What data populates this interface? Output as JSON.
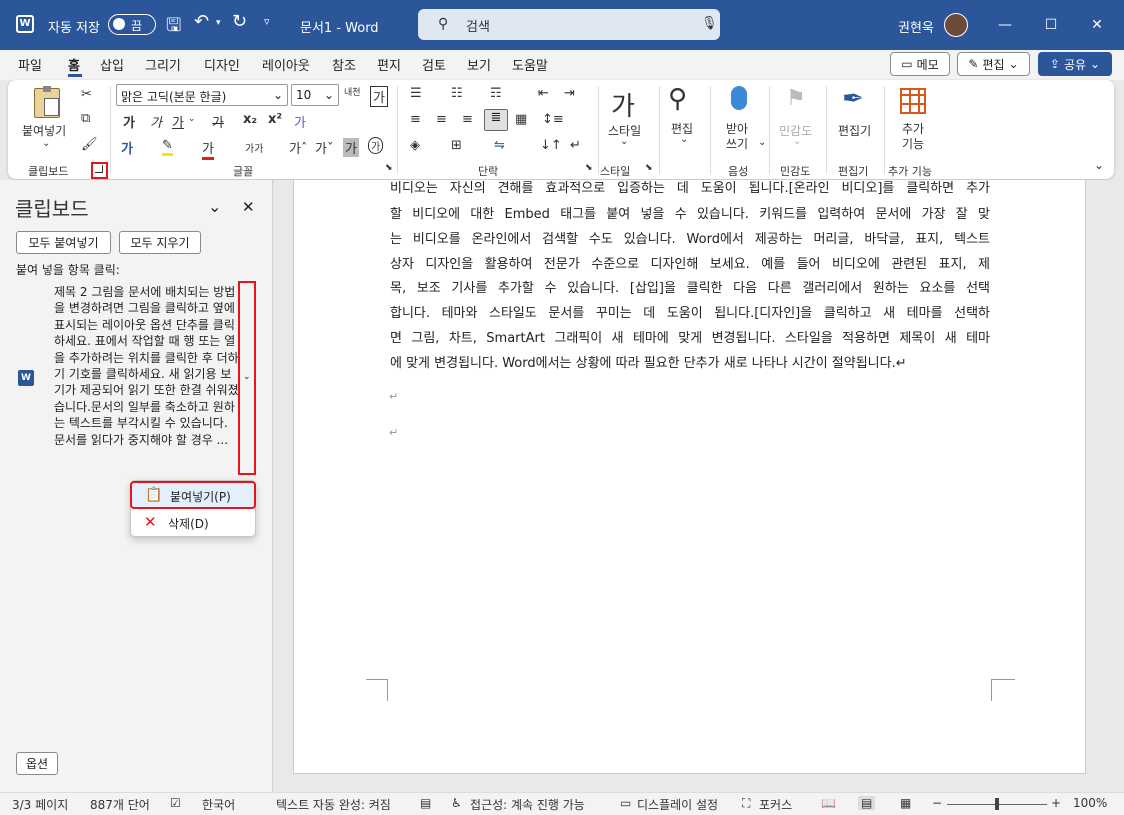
{
  "titlebar": {
    "autosave_label": "자동 저장",
    "autosave_state": "끔",
    "doc_title": "문서1 - Word",
    "search_placeholder": "검색",
    "user_name": "권현욱"
  },
  "menu": [
    "파일",
    "홈",
    "삽입",
    "그리기",
    "디자인",
    "레이아웃",
    "참조",
    "편지",
    "검토",
    "보기",
    "도움말"
  ],
  "menu_active": "홈",
  "top_buttons": {
    "memo": "메모",
    "edit": "편집",
    "share": "공유"
  },
  "ribbon": {
    "paste": "붙여넣기",
    "font_name": "맑은 고딕(본문 한글)",
    "font_size": "10",
    "style_label": "스타일",
    "editing_label": "편집",
    "dictate_label": "받아\n쓰기",
    "sensitivity_label": "민감도",
    "editor_label": "편집기",
    "addins_label": "추가\n기능",
    "groups": [
      "클립보드",
      "글꼴",
      "단락",
      "스타일",
      "음성",
      "민감도",
      "편집기",
      "추가 기능"
    ]
  },
  "clipboard_pane": {
    "title": "클립보드",
    "paste_all": "모두 붙여넣기",
    "clear_all": "모두 지우기",
    "instruction": "붙여 넣을 항목 클릭:",
    "item_text": "제목 2 그림을 문서에 배치되는 방법을 변경하려면 그림을 클릭하고 옆에 표시되는 레이아웃 옵션 단추를 클릭하세요. 표에서 작업할 때 행 또는 열을 추가하려는 위치를 클릭한 후 더하기 기호를 클릭하세요. 새 읽기용 보기가 제공되어 읽기 또한 한결 쉬워졌습니다.문서의 일부를 축소하고 원하는 텍스트를 부각시킬 수 있습니다. 문서를 읽다가 중지해야 할 경우 ...",
    "options": "옵션"
  },
  "context_menu": {
    "paste": "붙여넣기(P)",
    "delete": "삭제(D)"
  },
  "document_lines": [
    "비디오는 자신의 견해를 효과적으로 입증하는 데 도움이 됩니다.[온라인 비디오]를 클릭하면 추가",
    "할 비디오에 대한 Embed 태그를 붙여 넣을 수 있습니다. 키워드를 입력하여 문서에 가장 잘 맞",
    "는 비디오를 온라인에서 검색할 수도 있습니다. Word에서 제공하는 머리글, 바닥글, 표지, 텍스트",
    "상자 디자인을 활용하여 전문가 수준으로 디자인해 보세요. 예를 들어 비디오에 관련된 표지, 제",
    "목, 보조 기사를 추가할 수 있습니다. [삽입]을 클릭한 다음 다른 갤러리에서 원하는 요소를 선택",
    "합니다. 테마와 스타일도 문서를 꾸미는 데 도움이 됩니다.[디자인]을 클릭하고 새 테마를 선택하",
    "면 그림, 차트, SmartArt 그래픽이 새 테마에 맞게 변경됩니다. 스타일을 적용하면 제목이 새 테마",
    "에 맞게 변경됩니다. Word에서는 상황에 따라 필요한 단추가 새로 나타나 시간이 절약됩니다.↵"
  ],
  "status": {
    "page": "3/3 페이지",
    "words": "887개 단어",
    "language": "한국어",
    "autocomplete": "텍스트 자동 완성: 켜짐",
    "accessibility": "접근성: 계속 진행 가능",
    "display": "디스플레이 설정",
    "focus": "포커스",
    "zoom": "100%"
  },
  "colors": {
    "titlebar": "#2b579a",
    "highlight": "#e8141c"
  }
}
